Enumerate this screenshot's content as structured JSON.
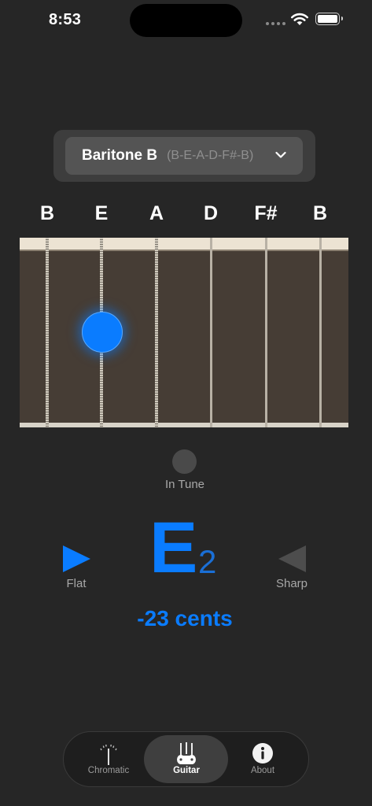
{
  "status_bar": {
    "time": "8:53"
  },
  "tuning_selector": {
    "name": "Baritone B",
    "notes": "(B-E-A-D-F#-B)"
  },
  "strings": [
    "B",
    "E",
    "A",
    "D",
    "F#",
    "B"
  ],
  "fretboard": {
    "active_string_index": 1
  },
  "tune_indicator": {
    "label": "In Tune"
  },
  "note_display": {
    "letter": "E",
    "octave": "2",
    "flat_label": "Flat",
    "sharp_label": "Sharp",
    "cents": "-23 cents"
  },
  "tabs": [
    {
      "label": "Chromatic",
      "icon": "tuning-fork-icon",
      "active": false
    },
    {
      "label": "Guitar",
      "icon": "guitars-icon",
      "active": true
    },
    {
      "label": "About",
      "icon": "info-icon",
      "active": false
    }
  ],
  "colors": {
    "accent": "#0a7cff",
    "background": "#262626"
  }
}
